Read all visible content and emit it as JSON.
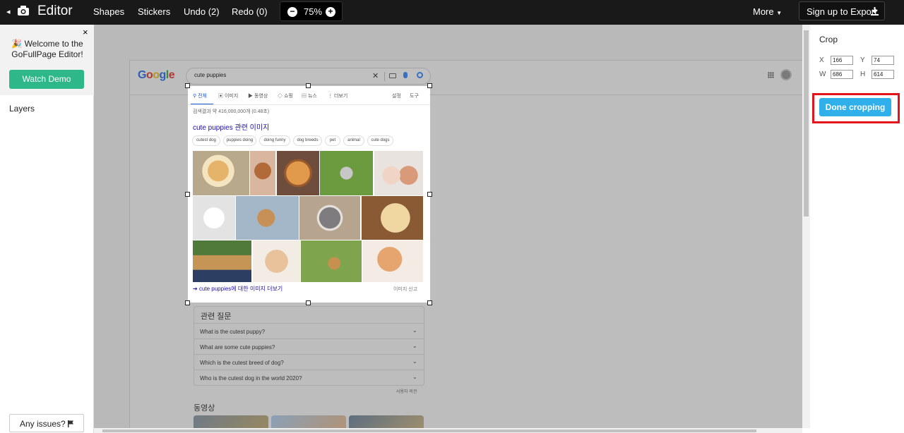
{
  "topbar": {
    "title": "Editor",
    "menu": [
      "Shapes",
      "Stickers",
      "Undo (2)",
      "Redo (0)"
    ],
    "zoom": "75%",
    "zoom_minus": "−",
    "zoom_plus": "+",
    "more": "More",
    "signup": "Sign up to Export",
    "back_glyph": "◂"
  },
  "left": {
    "welcome_emoji": "🎉",
    "welcome_text": "Welcome to the GoFullPage Editor!",
    "close": "×",
    "watch_demo": "Watch Demo",
    "layers": "Layers",
    "issues": "Any issues?"
  },
  "right": {
    "crop_title": "Crop",
    "x_label": "X",
    "x_value": "166",
    "y_label": "Y",
    "y_value": "74",
    "w_label": "W",
    "w_value": "686",
    "h_label": "H",
    "h_value": "614",
    "done": "Done cropping"
  },
  "page": {
    "google": "Google",
    "query": "cute puppies",
    "clear": "✕",
    "tabs": [
      "전체",
      "이미지",
      "동영상",
      "쇼핑",
      "뉴스",
      "⋮ 더보기"
    ],
    "settings": "설정",
    "tools": "도구",
    "count": "검색결과 약 416,000,000개 (0.48초)",
    "images_title": "cute puppies 관련 이미지",
    "chips": [
      "cutest dog",
      "puppies doing",
      "doing funny",
      "dog breeds",
      "pet",
      "animal",
      "cute dogs"
    ],
    "more_images": "cute puppies에 대한 이미지 더보기",
    "report": "이미지 신고",
    "rq_title": "관련 질문",
    "questions": [
      "What is the cutest puppy?",
      "What are some cute puppies?",
      "Which is the cutest breed of dog?",
      "Who is the cutest dog in the world 2020?"
    ],
    "feedback": "사용자 의견",
    "videos_title": "동영상"
  },
  "colors": {
    "accent_green": "#2eb88a",
    "done_blue": "#2fb0ea",
    "highlight_red": "#e3141b",
    "topbar": "#191919"
  }
}
